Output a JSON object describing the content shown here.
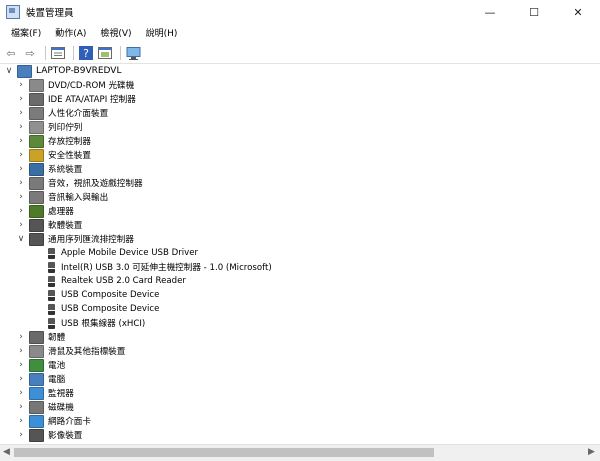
{
  "window": {
    "title": "裝置管理員",
    "minimize": "—",
    "maximize": "☐",
    "close": "✕"
  },
  "menu": [
    "檔案(F)",
    "動作(A)",
    "檢視(V)",
    "說明(H)"
  ],
  "toolbar": {
    "back": "⇦",
    "forward": "⇨",
    "help": "?"
  },
  "tree": {
    "root": {
      "label": "LAPTOP-B9VREDVL",
      "expander": "∨",
      "icon": "computer-icon",
      "color": "#4a7fbf"
    },
    "categories": [
      {
        "label": "DVD/CD-ROM 光碟機",
        "expander": "›",
        "icon": "dvd-drive-icon",
        "color": "#8a8a8a"
      },
      {
        "label": "IDE ATA/ATAPI 控制器",
        "expander": "›",
        "icon": "ide-controller-icon",
        "color": "#6b6b6b"
      },
      {
        "label": "人性化介面裝置",
        "expander": "›",
        "icon": "hid-icon",
        "color": "#7b7b7b"
      },
      {
        "label": "列印佇列",
        "expander": "›",
        "icon": "printer-icon",
        "color": "#909090"
      },
      {
        "label": "存放控制器",
        "expander": "›",
        "icon": "storage-controller-icon",
        "color": "#5d8a3a"
      },
      {
        "label": "安全性裝置",
        "expander": "›",
        "icon": "security-icon",
        "color": "#c9a227"
      },
      {
        "label": "系統裝置",
        "expander": "›",
        "icon": "system-device-icon",
        "color": "#3a6ea5"
      },
      {
        "label": "音效，視訊及遊戲控制器",
        "expander": "›",
        "icon": "speaker-icon",
        "color": "#7a7a7a"
      },
      {
        "label": "音訊輸入與輸出",
        "expander": "›",
        "icon": "audio-icon",
        "color": "#7a7a7a"
      },
      {
        "label": "處理器",
        "expander": "›",
        "icon": "processor-icon",
        "color": "#4f7a2a"
      },
      {
        "label": "軟體裝置",
        "expander": "›",
        "icon": "software-device-icon",
        "color": "#555555"
      },
      {
        "label": "通用序列匯流排控制器",
        "expander": "∨",
        "icon": "usb-icon",
        "color": "#555555",
        "children": [
          {
            "label": "Apple Mobile Device USB Driver",
            "icon": "usb-device-icon"
          },
          {
            "label": "Intel(R) USB 3.0 可延伸主機控制器 - 1.0 (Microsoft)",
            "icon": "usb-device-icon"
          },
          {
            "label": "Realtek USB 2.0 Card Reader",
            "icon": "usb-device-icon"
          },
          {
            "label": "USB Composite Device",
            "icon": "usb-device-icon"
          },
          {
            "label": "USB Composite Device",
            "icon": "usb-device-icon"
          },
          {
            "label": "USB 根集線器 (xHCI)",
            "icon": "usb-device-icon"
          }
        ]
      },
      {
        "label": "韌體",
        "expander": "›",
        "icon": "firmware-icon",
        "color": "#6a6a6a"
      },
      {
        "label": "滑鼠及其他指標裝置",
        "expander": "›",
        "icon": "mouse-icon",
        "color": "#8a8a8a"
      },
      {
        "label": "電池",
        "expander": "›",
        "icon": "battery-icon",
        "color": "#3f8f3f"
      },
      {
        "label": "電腦",
        "expander": "›",
        "icon": "computer-icon",
        "color": "#4a7fbf"
      },
      {
        "label": "監視器",
        "expander": "›",
        "icon": "monitor-icon",
        "color": "#3d8fd6"
      },
      {
        "label": "磁碟機",
        "expander": "›",
        "icon": "disk-drive-icon",
        "color": "#777777"
      },
      {
        "label": "網路介面卡",
        "expander": "›",
        "icon": "network-adapter-icon",
        "color": "#3d8fd6"
      },
      {
        "label": "影像裝置",
        "expander": "›",
        "icon": "camera-icon",
        "color": "#555555"
      }
    ]
  }
}
